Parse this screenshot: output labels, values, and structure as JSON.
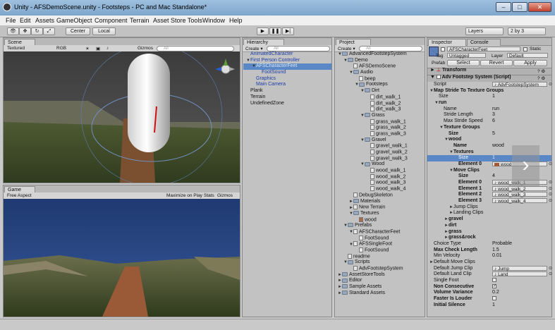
{
  "window": {
    "title": "Unity - AFSDemoScene.unity - Footsteps - PC and Mac Standalone*",
    "minimize": "–",
    "maximize": "□",
    "close": "✕"
  },
  "menu": [
    "File",
    "Edit",
    "Assets",
    "GameObject",
    "Component",
    "Terrain",
    "Asset Store Tools",
    "Window",
    "Help"
  ],
  "toolbar": {
    "center": "Center",
    "local": "Local",
    "layers": "Layers",
    "layout": "2 by 3"
  },
  "scene": {
    "tab": "Scene",
    "shading": "Textured",
    "render": "RGB",
    "gizmos": "Gizmos",
    "search": "All"
  },
  "game": {
    "tab": "Game",
    "aspect": "Free Aspect",
    "maximize": "Maximize on Play",
    "stats": "Stats",
    "gizmos": "Gizmos"
  },
  "hierarchy": {
    "tab": "Hierarchy",
    "create": "Create",
    "search": "All",
    "items": [
      {
        "label": "AnimatedCharacter",
        "indent": 0,
        "blue": true,
        "arrow": ""
      },
      {
        "label": "First Person Controller",
        "indent": 0,
        "blue": true,
        "arrow": "▼"
      },
      {
        "label": "AFSCharacterFeet",
        "indent": 1,
        "blue": true,
        "arrow": "▼",
        "selected": true
      },
      {
        "label": "FootSound",
        "indent": 2,
        "blue": true,
        "arrow": ""
      },
      {
        "label": "Graphics",
        "indent": 1,
        "blue": true,
        "arrow": ""
      },
      {
        "label": "Main Camera",
        "indent": 1,
        "blue": true,
        "arrow": ""
      },
      {
        "label": "Plank",
        "indent": 0,
        "blue": false,
        "arrow": ""
      },
      {
        "label": "Terrain",
        "indent": 0,
        "blue": false,
        "arrow": ""
      },
      {
        "label": "UndefinedZone",
        "indent": 0,
        "blue": false,
        "arrow": ""
      }
    ]
  },
  "project": {
    "tab": "Project",
    "create": "Create",
    "search": "All",
    "items": [
      {
        "label": "AdvancedFootstepSystem",
        "indent": 0,
        "type": "folder",
        "arrow": "▼"
      },
      {
        "label": "Demo",
        "indent": 1,
        "type": "folder",
        "arrow": "▼"
      },
      {
        "label": "AFSDemoScene",
        "indent": 2,
        "type": "file",
        "arrow": ""
      },
      {
        "label": "Audio",
        "indent": 2,
        "type": "folder",
        "arrow": "▼"
      },
      {
        "label": "beep",
        "indent": 3,
        "type": "file",
        "arrow": ""
      },
      {
        "label": "Footsteps",
        "indent": 3,
        "type": "folder",
        "arrow": "▼"
      },
      {
        "label": "Dirt",
        "indent": 4,
        "type": "folder",
        "arrow": "▼"
      },
      {
        "label": "dirt_walk_1",
        "indent": 5,
        "type": "file",
        "arrow": ""
      },
      {
        "label": "dirt_walk_2",
        "indent": 5,
        "type": "file",
        "arrow": ""
      },
      {
        "label": "dirt_walk_3",
        "indent": 5,
        "type": "file",
        "arrow": ""
      },
      {
        "label": "Grass",
        "indent": 4,
        "type": "folder",
        "arrow": "▼"
      },
      {
        "label": "grass_walk_1",
        "indent": 5,
        "type": "file",
        "arrow": ""
      },
      {
        "label": "grass_walk_2",
        "indent": 5,
        "type": "file",
        "arrow": ""
      },
      {
        "label": "grass_walk_3",
        "indent": 5,
        "type": "file",
        "arrow": ""
      },
      {
        "label": "Gravel",
        "indent": 4,
        "type": "folder",
        "arrow": "▼"
      },
      {
        "label": "gravel_walk_1",
        "indent": 5,
        "type": "file",
        "arrow": ""
      },
      {
        "label": "gravel_walk_2",
        "indent": 5,
        "type": "file",
        "arrow": ""
      },
      {
        "label": "gravel_walk_3",
        "indent": 5,
        "type": "file",
        "arrow": ""
      },
      {
        "label": "Wood",
        "indent": 4,
        "type": "folder",
        "arrow": "▼"
      },
      {
        "label": "wood_walk_1",
        "indent": 5,
        "type": "file",
        "arrow": ""
      },
      {
        "label": "wood_walk_2",
        "indent": 5,
        "type": "file",
        "arrow": ""
      },
      {
        "label": "wood_walk_3",
        "indent": 5,
        "type": "file",
        "arrow": ""
      },
      {
        "label": "wood_walk_4",
        "indent": 5,
        "type": "file",
        "arrow": ""
      },
      {
        "label": "DebugSkeleton",
        "indent": 2,
        "type": "file",
        "arrow": ""
      },
      {
        "label": "Materials",
        "indent": 2,
        "type": "folder",
        "arrow": "►"
      },
      {
        "label": "New Terrain",
        "indent": 2,
        "type": "file",
        "arrow": "►"
      },
      {
        "label": "Textures",
        "indent": 2,
        "type": "folder",
        "arrow": "▼"
      },
      {
        "label": "wood",
        "indent": 3,
        "type": "texture",
        "arrow": ""
      },
      {
        "label": "Prefabs",
        "indent": 1,
        "type": "folder",
        "arrow": "▼"
      },
      {
        "label": "AFSCharacterFeet",
        "indent": 2,
        "type": "file",
        "arrow": "▼"
      },
      {
        "label": "FootSound",
        "indent": 3,
        "type": "file",
        "arrow": ""
      },
      {
        "label": "AFSSingleFoot",
        "indent": 2,
        "type": "file",
        "arrow": "▼"
      },
      {
        "label": "FootSound",
        "indent": 3,
        "type": "file",
        "arrow": ""
      },
      {
        "label": "readme",
        "indent": 1,
        "type": "file",
        "arrow": ""
      },
      {
        "label": "Scripts",
        "indent": 1,
        "type": "folder",
        "arrow": "▼"
      },
      {
        "label": "AdvFootstepSystem",
        "indent": 2,
        "type": "file",
        "arrow": ""
      },
      {
        "label": "AssetStoreTools",
        "indent": 0,
        "type": "folder",
        "arrow": "►"
      },
      {
        "label": "Editor",
        "indent": 0,
        "type": "folder",
        "arrow": "►"
      },
      {
        "label": "Sample Assets",
        "indent": 0,
        "type": "folder",
        "arrow": "►"
      },
      {
        "label": "Standard Assets",
        "indent": 0,
        "type": "folder",
        "arrow": "►"
      }
    ]
  },
  "inspector": {
    "tab": "Inspector",
    "tab2": "Console",
    "object_name": "AFSCharacterFeet",
    "static": "Static",
    "tag_label": "Tag",
    "tag": "Untagged",
    "layer_label": "Layer",
    "layer": "Default",
    "prefab_label": "Prefab",
    "select": "Select",
    "revert": "Revert",
    "apply": "Apply",
    "transform": "Transform",
    "component": "Adv Footstep System (Script)",
    "rows": [
      {
        "label": "Script",
        "value": "AdvFootstepSystem",
        "indent": 0,
        "arrow": "",
        "bold": false,
        "kind": "obj"
      },
      {
        "label": "Map Stride To Texture Groups",
        "value": "",
        "indent": 0,
        "arrow": "▼",
        "bold": true,
        "kind": ""
      },
      {
        "label": "Size",
        "value": "1",
        "indent": 1,
        "arrow": "",
        "bold": false,
        "kind": ""
      },
      {
        "label": "run",
        "value": "",
        "indent": 1,
        "arrow": "▼",
        "bold": true,
        "kind": ""
      },
      {
        "label": "Name",
        "value": "run",
        "indent": 2,
        "arrow": "",
        "bold": false,
        "kind": ""
      },
      {
        "label": "Stride Length",
        "value": "3",
        "indent": 2,
        "arrow": "",
        "bold": false,
        "kind": ""
      },
      {
        "label": "Max Stride Speed",
        "value": "6",
        "indent": 2,
        "arrow": "",
        "bold": false,
        "kind": ""
      },
      {
        "label": "Texture Groups",
        "value": "",
        "indent": 2,
        "arrow": "▼",
        "bold": true,
        "kind": ""
      },
      {
        "label": "Size",
        "value": "5",
        "indent": 3,
        "arrow": "",
        "bold": true,
        "kind": ""
      },
      {
        "label": "wood",
        "value": "",
        "indent": 3,
        "arrow": "▼",
        "bold": true,
        "kind": ""
      },
      {
        "label": "Name",
        "value": "wood",
        "indent": 4,
        "arrow": "",
        "bold": true,
        "kind": ""
      },
      {
        "label": "Textures",
        "value": "",
        "indent": 4,
        "arrow": "▼",
        "bold": true,
        "kind": ""
      },
      {
        "label": "Size",
        "value": "1",
        "indent": 5,
        "arrow": "",
        "bold": true,
        "kind": "",
        "selected": true
      },
      {
        "label": "Element 0",
        "value": "wood",
        "indent": 5,
        "arrow": "",
        "bold": true,
        "kind": "tex"
      },
      {
        "label": "Move Clips",
        "value": "",
        "indent": 4,
        "arrow": "▼",
        "bold": true,
        "kind": ""
      },
      {
        "label": "Size",
        "value": "4",
        "indent": 5,
        "arrow": "",
        "bold": true,
        "kind": ""
      },
      {
        "label": "Element 0",
        "value": "wood_walk_1",
        "indent": 5,
        "arrow": "",
        "bold": true,
        "kind": "obj"
      },
      {
        "label": "Element 1",
        "value": "wood_walk_2",
        "indent": 5,
        "arrow": "",
        "bold": true,
        "kind": "obj"
      },
      {
        "label": "Element 2",
        "value": "wood_walk_3",
        "indent": 5,
        "arrow": "",
        "bold": true,
        "kind": "obj"
      },
      {
        "label": "Element 3",
        "value": "wood_walk_4",
        "indent": 5,
        "arrow": "",
        "bold": true,
        "kind": "obj"
      },
      {
        "label": "Jump Clips",
        "value": "",
        "indent": 4,
        "arrow": "►",
        "bold": false,
        "kind": ""
      },
      {
        "label": "Landing Clips",
        "value": "",
        "indent": 4,
        "arrow": "►",
        "bold": false,
        "kind": ""
      },
      {
        "label": "gravel",
        "value": "",
        "indent": 3,
        "arrow": "►",
        "bold": true,
        "kind": ""
      },
      {
        "label": "dirt",
        "value": "",
        "indent": 3,
        "arrow": "►",
        "bold": true,
        "kind": ""
      },
      {
        "label": "grass",
        "value": "",
        "indent": 3,
        "arrow": "►",
        "bold": true,
        "kind": ""
      },
      {
        "label": "grass&rock",
        "value": "",
        "indent": 3,
        "arrow": "►",
        "bold": true,
        "kind": ""
      },
      {
        "label": "Choice Type",
        "value": "Probable",
        "indent": 0,
        "arrow": "",
        "bold": false,
        "kind": ""
      },
      {
        "label": "Max Check Length",
        "value": "1.5",
        "indent": 0,
        "arrow": "",
        "bold": true,
        "kind": ""
      },
      {
        "label": "Min Velocity",
        "value": "0.01",
        "indent": 0,
        "arrow": "",
        "bold": false,
        "kind": ""
      },
      {
        "label": "Default Move Clips",
        "value": "",
        "indent": 0,
        "arrow": "►",
        "bold": false,
        "kind": ""
      },
      {
        "label": "Default Jump Clip",
        "value": "Jump",
        "indent": 0,
        "arrow": "",
        "bold": false,
        "kind": "obj"
      },
      {
        "label": "Default Land Clip",
        "value": "Land",
        "indent": 0,
        "arrow": "",
        "bold": false,
        "kind": "obj"
      },
      {
        "label": "Single Foot",
        "value": "",
        "indent": 0,
        "arrow": "",
        "bold": false,
        "kind": "chk"
      },
      {
        "label": "Non Consecutive",
        "value": "",
        "indent": 0,
        "arrow": "",
        "bold": true,
        "kind": "chkon"
      },
      {
        "label": "Volume Variance",
        "value": "0.2",
        "indent": 0,
        "arrow": "",
        "bold": true,
        "kind": ""
      },
      {
        "label": "Faster Is Louder",
        "value": "",
        "indent": 0,
        "arrow": "",
        "bold": true,
        "kind": "chk"
      },
      {
        "label": "Initial Silence",
        "value": "1",
        "indent": 0,
        "arrow": "",
        "bold": true,
        "kind": ""
      }
    ]
  },
  "colors": {
    "selection": "#5a88c6",
    "sky": "#2f4f8c",
    "window_frame": "#7ea6cc"
  }
}
